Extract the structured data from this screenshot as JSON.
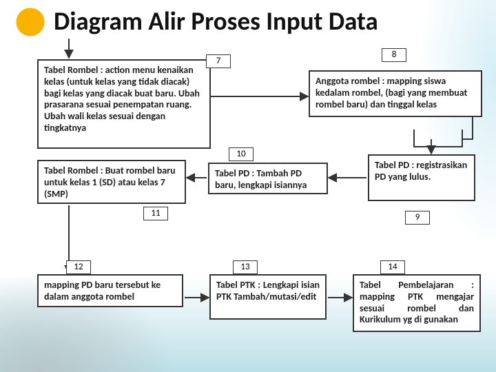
{
  "title": "Diagram Alir Proses Input Data",
  "nodes": {
    "n7": {
      "num": "7",
      "text": "Tabel Rombel : action menu kenaikan kelas (untuk kelas yang tidak diacak) bagi kelas yang diacak buat baru. Ubah prasarana sesuai penempatan ruang.  Ubah wali kelas sesuai dengan tingkatnya"
    },
    "n8": {
      "num": "8",
      "text": "Anggota rombel : mapping siswa kedalam rombel, (bagi yang membuat rombel baru) dan tinggal kelas"
    },
    "n9": {
      "num": "9",
      "text": "Tabel PD : registrasikan PD yang lulus."
    },
    "n10": {
      "num": "10",
      "text": "Tabel PD : Tambah PD baru, lengkapi isiannya"
    },
    "n11": {
      "num": "11",
      "text": "Tabel Rombel : Buat rombel baru untuk kelas 1 (SD) atau kelas 7 (SMP)"
    },
    "n12": {
      "num": "12",
      "text": "mapping PD baru tersebut ke dalam anggota rombel"
    },
    "n13": {
      "num": "13",
      "text": "Tabel PTK : Lengkapi isian PTK Tambah/mutasi/edit"
    },
    "n14": {
      "num": "14",
      "text": "Tabel Pembelajaran : mapping PTK mengajar sesuai rombel dan Kurikulum yg di gunakan"
    }
  }
}
